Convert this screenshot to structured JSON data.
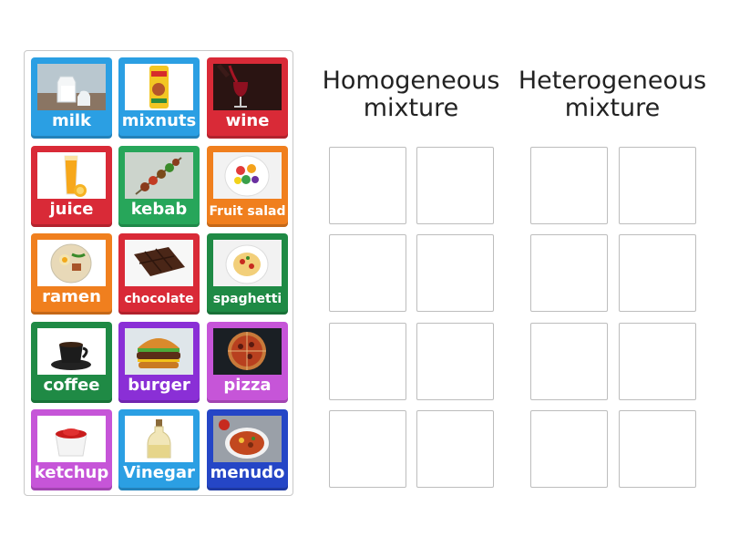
{
  "cards": [
    {
      "label": "milk",
      "color": "blue",
      "icon": "milk-icon"
    },
    {
      "label": "mixnuts",
      "color": "navy",
      "icon": "mixnuts-icon"
    },
    {
      "label": "wine",
      "color": "red",
      "icon": "wine-icon"
    },
    {
      "label": "juice",
      "color": "red",
      "icon": "juice-icon"
    },
    {
      "label": "kebab",
      "color": "green",
      "icon": "kebab-icon"
    },
    {
      "label": "Fruit salad",
      "color": "orange",
      "icon": "fruit-salad-icon"
    },
    {
      "label": "ramen",
      "color": "orange",
      "icon": "ramen-icon"
    },
    {
      "label": "chocolate",
      "color": "orange",
      "icon": "chocolate-icon"
    },
    {
      "label": "spaghetti",
      "color": "dgreen",
      "icon": "spaghetti-icon"
    },
    {
      "label": "coffee",
      "color": "dgreen",
      "icon": "coffee-icon"
    },
    {
      "label": "burger",
      "color": "purple",
      "icon": "burger-icon"
    },
    {
      "label": "pizza",
      "color": "pink",
      "icon": "pizza-icon"
    },
    {
      "label": "ketchup",
      "color": "pink",
      "icon": "ketchup-icon"
    },
    {
      "label": "Vinegar",
      "color": "blue",
      "icon": "vinegar-icon"
    },
    {
      "label": "menudo",
      "color": "navy",
      "icon": "menudo-icon"
    }
  ],
  "groups": [
    {
      "title_line1": "Homogeneous",
      "title_line2": "mixture",
      "slots": 8
    },
    {
      "title_line1": "Heterogeneous",
      "title_line2": "mixture",
      "slots": 8
    }
  ],
  "colors": {
    "blue": "#2b9fe3",
    "red": "#d92a37",
    "green": "#27a65a",
    "orange": "#f07f1e",
    "purple": "#8a2fd6",
    "pink": "#c655d8",
    "navy": "#2546c6",
    "dgreen": "#1f8a45"
  }
}
